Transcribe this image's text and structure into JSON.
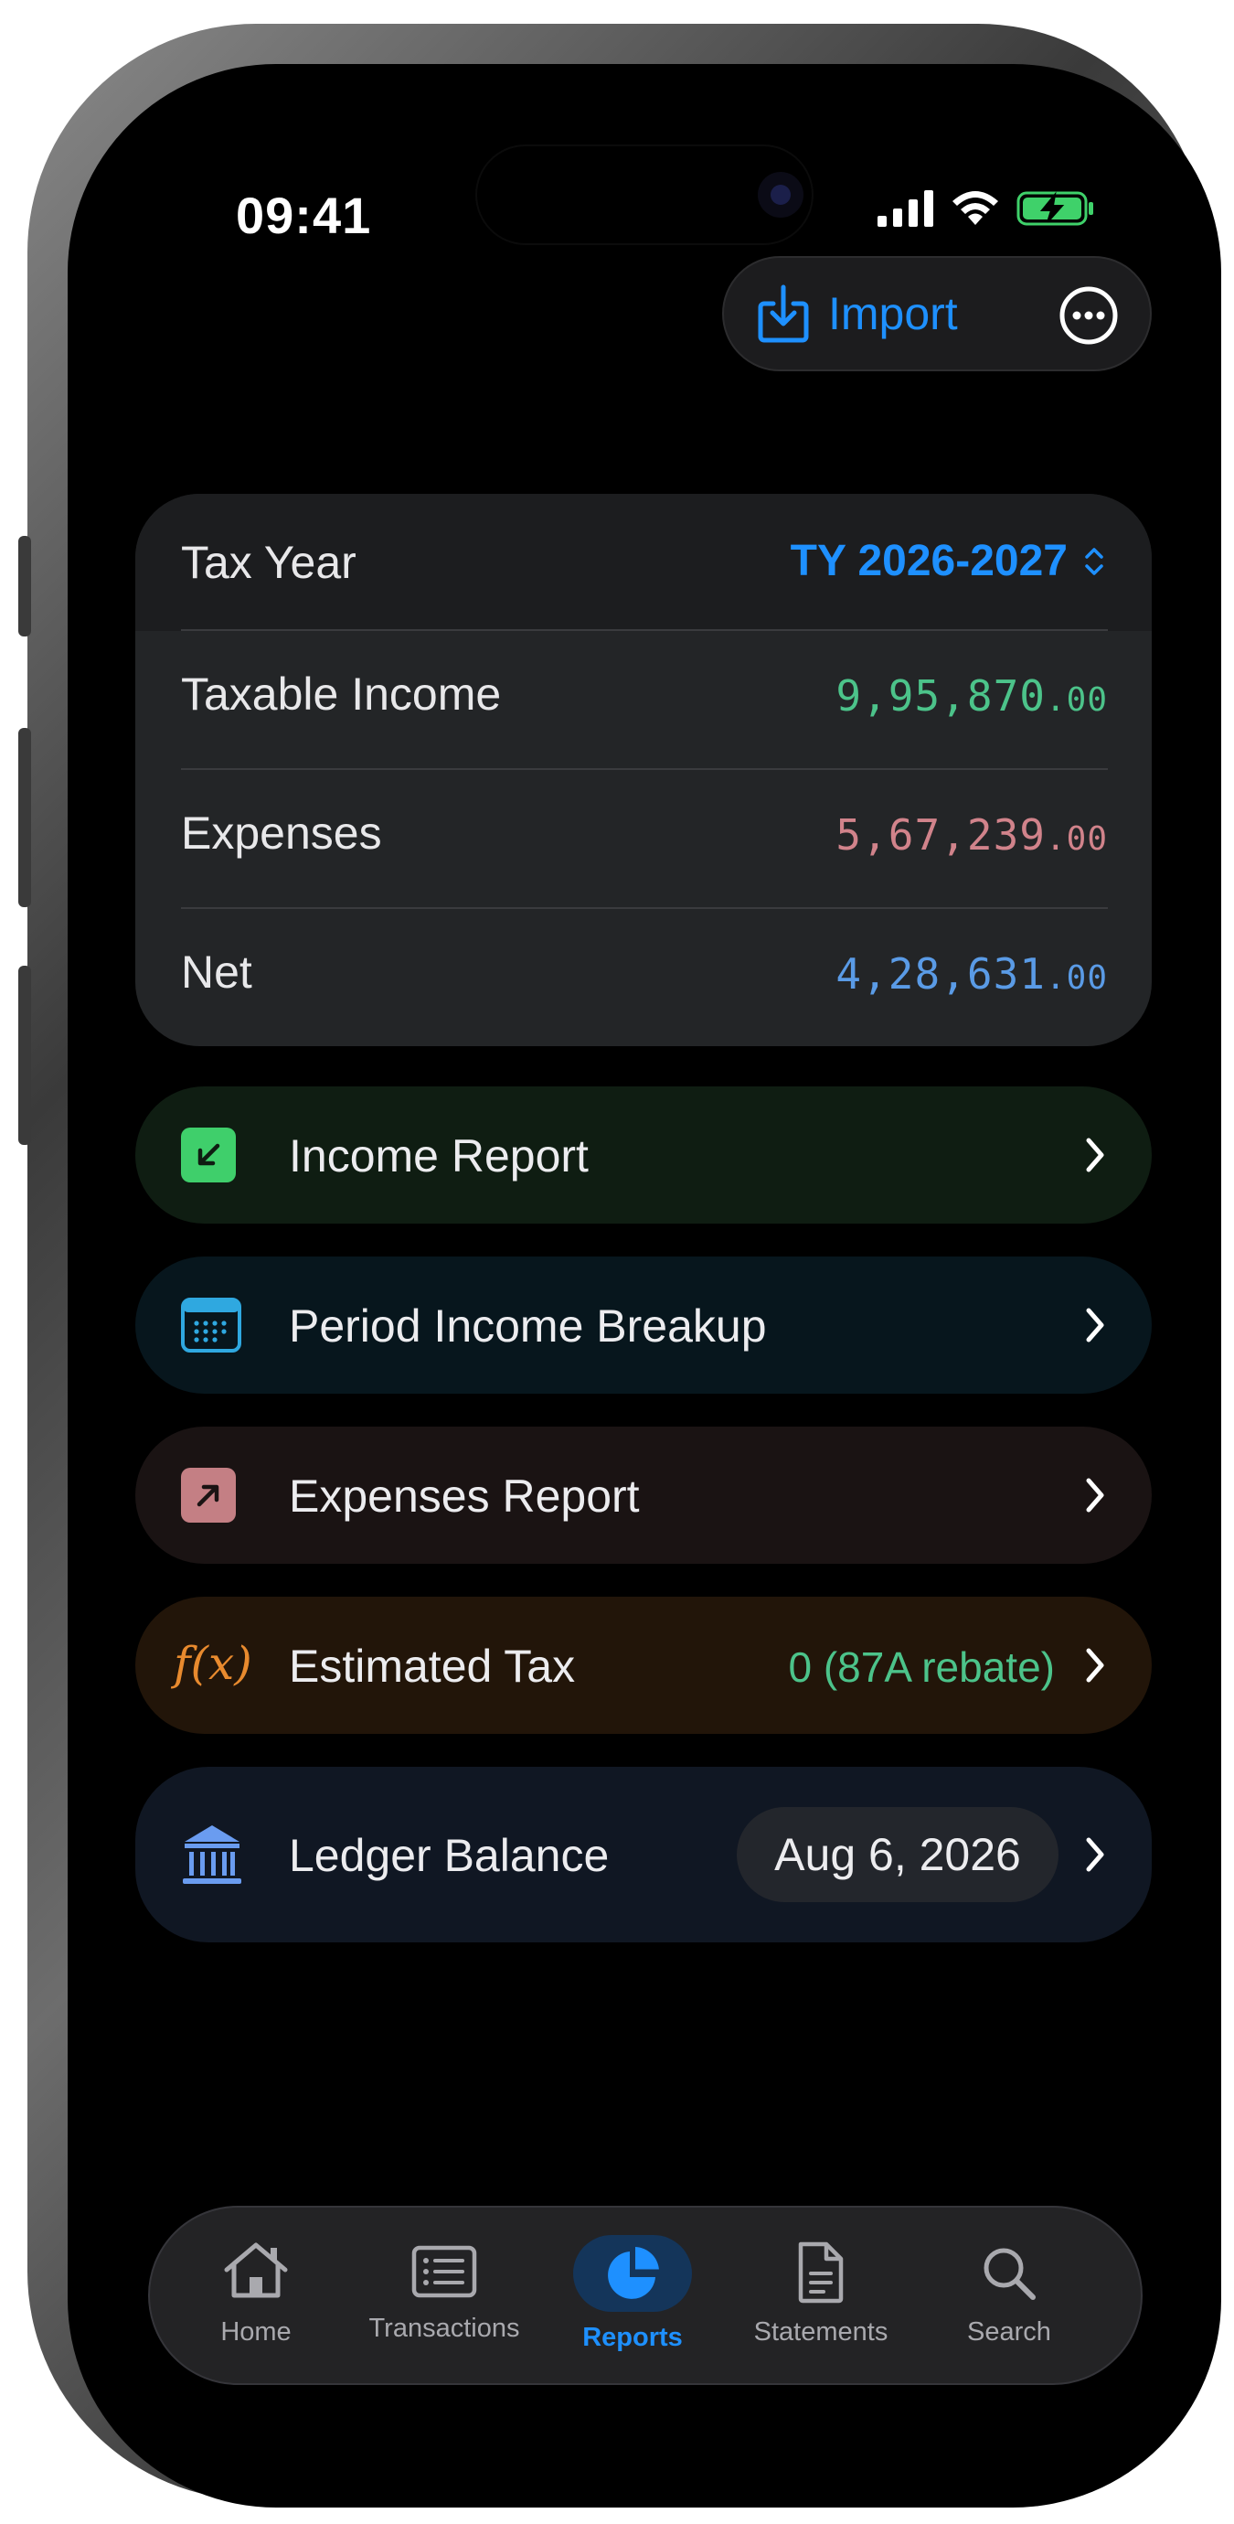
{
  "status_bar": {
    "time": "09:41",
    "icons": [
      "cellular-signal-icon",
      "wifi-icon",
      "battery-charging-icon"
    ]
  },
  "toolbar": {
    "import_label": "Import",
    "import_icon": "import-tray-icon",
    "more_icon": "ellipsis-circle-icon"
  },
  "summary": {
    "tax_year_label": "Tax Year",
    "tax_year_value": "TY 2026-2027",
    "rows": [
      {
        "label": "Taxable Income",
        "value": "9,95,870",
        "decimals": ".00",
        "color": "#4cc38a"
      },
      {
        "label": "Expenses",
        "value": "5,67,239",
        "decimals": ".00",
        "color": "#d1838b"
      },
      {
        "label": "Net",
        "value": "4,28,631",
        "decimals": ".00",
        "color": "#5a9be6"
      }
    ]
  },
  "reports": [
    {
      "label": "Income Report",
      "icon": "arrow-down-left-square-icon",
      "bg": "#0f1d12",
      "accent": "#3fcf6b"
    },
    {
      "label": "Period Income Breakup",
      "icon": "calendar-grid-icon",
      "bg": "#07161d",
      "accent": "#2fa8e0"
    },
    {
      "label": "Expenses Report",
      "icon": "arrow-up-right-square-icon",
      "bg": "#1a1313",
      "accent": "#c47f84"
    },
    {
      "label": "Estimated Tax",
      "icon": "function-icon",
      "icon_text": "f(x)",
      "value": "0 (87A rebate)",
      "bg": "#221509",
      "accent": "#e88a2e",
      "value_color": "#4cc38a"
    },
    {
      "label": "Ledger Balance",
      "icon": "bank-building-icon",
      "badge": "Aug 6, 2026",
      "bg": "#101723",
      "accent": "#6a9cf0"
    }
  ],
  "tabs": [
    {
      "label": "Home",
      "icon": "house-icon",
      "active": false
    },
    {
      "label": "Transactions",
      "icon": "list-rectangle-icon",
      "active": false
    },
    {
      "label": "Reports",
      "icon": "pie-chart-icon",
      "active": true
    },
    {
      "label": "Statements",
      "icon": "document-icon",
      "active": false
    },
    {
      "label": "Search",
      "icon": "magnifying-glass-icon",
      "active": false
    }
  ],
  "colors": {
    "accent": "#1e90ff",
    "income": "#4cc38a",
    "expense": "#d1838b",
    "net": "#5a9be6"
  }
}
